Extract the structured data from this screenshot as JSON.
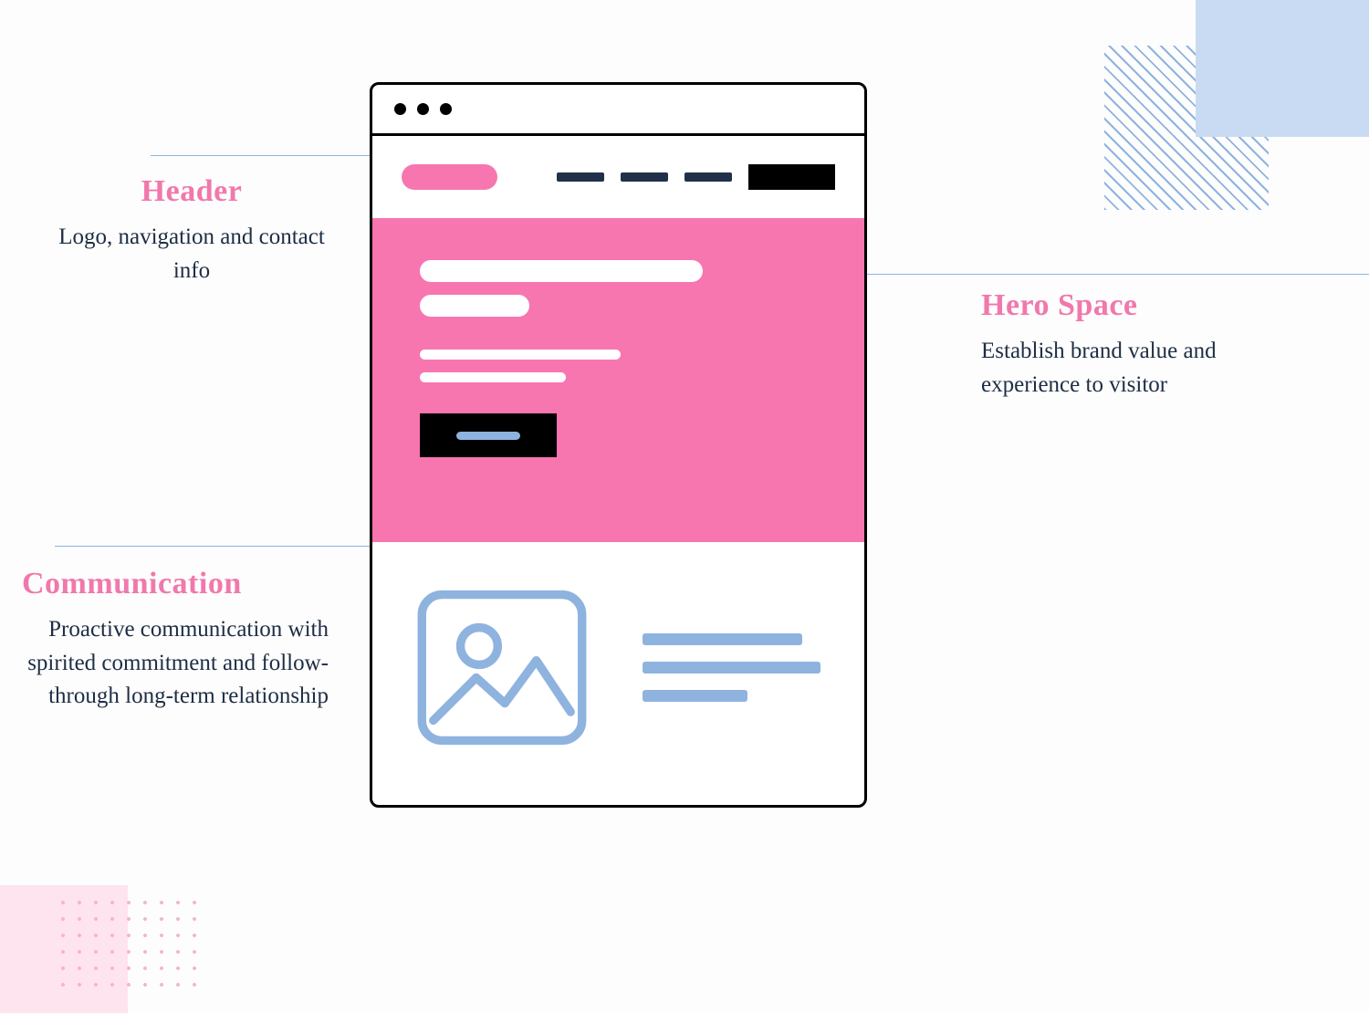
{
  "annotations": {
    "header": {
      "title": "Header",
      "body": "Logo, navigation and contact info"
    },
    "hero": {
      "title": "Hero Space",
      "body": "Establish brand value and experience to visitor"
    },
    "communication": {
      "title": "Communication",
      "body": "Proactive communication with spirited commitment and follow-through long-term relationship"
    }
  },
  "colors": {
    "accent_pink": "#f876b0",
    "accent_blue": "#8fb3df",
    "text_navy": "#1d2d44",
    "title_pink": "#f178ac"
  }
}
